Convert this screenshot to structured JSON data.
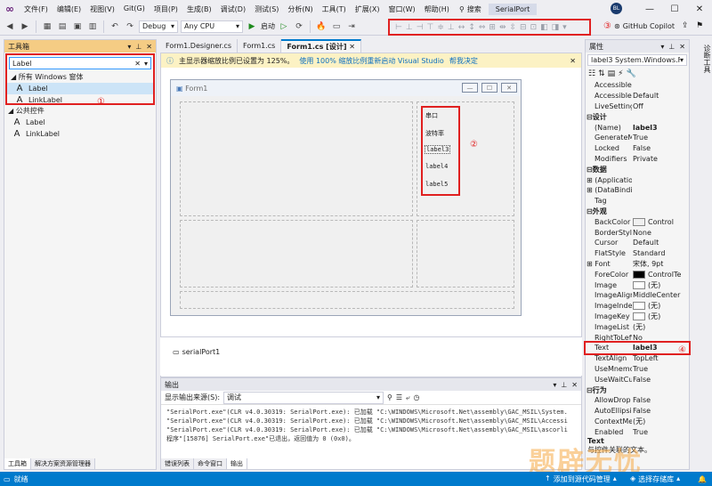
{
  "menu": {
    "items": [
      "文件(F)",
      "编辑(E)",
      "视图(V)",
      "Git(G)",
      "项目(P)",
      "生成(B)",
      "调试(D)",
      "测试(S)",
      "分析(N)",
      "工具(T)",
      "扩展(X)",
      "窗口(W)",
      "帮助(H)"
    ],
    "search_label": "搜索",
    "solution_name": "SerialPort",
    "avatar_initials": "BL"
  },
  "toolbar": {
    "config": "Debug",
    "platform": "Any CPU",
    "start_label": "启动",
    "copilot": "GitHub Copilot",
    "annotation": "③"
  },
  "toolbox": {
    "title": "工具箱",
    "search_value": "Label",
    "annotation": "①",
    "groups": [
      {
        "name": "所有 Windows 窗体",
        "items": [
          "Label",
          "LinkLabel"
        ]
      },
      {
        "name": "公共控件",
        "items": [
          "Label",
          "LinkLabel"
        ]
      }
    ],
    "bottom_tabs": [
      "工具箱",
      "解决方案资源管理器"
    ]
  },
  "doc_tabs": [
    "Form1.Designer.cs",
    "Form1.cs",
    "Form1.cs [设计]"
  ],
  "info_bar": {
    "message": "主显示器缩放比例已设置为 125%。",
    "link1": "使用 100% 缩放比例重新启动 Visual Studio",
    "link2": "帮我决定"
  },
  "form": {
    "title": "Form1",
    "labels": [
      "串口",
      "波特率",
      "label3",
      "label4",
      "label5"
    ],
    "annotation": "②"
  },
  "tray": {
    "component": "serialPort1"
  },
  "output": {
    "title": "输出",
    "source_label": "显示输出来源(S):",
    "source_value": "调试",
    "lines": [
      "\"SerialPort.exe\"(CLR v4.0.30319: SerialPort.exe): 已加载 \"C:\\WINDOWS\\Microsoft.Net\\assembly\\GAC_MSIL\\System.",
      "\"SerialPort.exe\"(CLR v4.0.30319: SerialPort.exe): 已加载 \"C:\\WINDOWS\\Microsoft.Net\\assembly\\GAC_MSIL\\Accessi",
      "\"SerialPort.exe\"(CLR v4.0.30319: SerialPort.exe): 已加载 \"C:\\WINDOWS\\Microsoft.Net\\assembly\\GAC_MSIL\\ascorli",
      "程序\"[15876] SerialPort.exe\"已退出，返回值为 0 (0x0)。"
    ],
    "bottom_tabs": [
      "错误列表",
      "命令窗口",
      "输出"
    ]
  },
  "properties": {
    "title": "属性",
    "object": "label3 System.Windows.Forr",
    "annotation": "④",
    "rows": [
      {
        "t": "p",
        "n": "AccessibleNa",
        "v": ""
      },
      {
        "t": "p",
        "n": "AccessibleRo",
        "v": "Default"
      },
      {
        "t": "p",
        "n": "LiveSetting",
        "v": "Off"
      },
      {
        "t": "c",
        "n": "设计"
      },
      {
        "t": "p",
        "n": "(Name)",
        "v": "label3",
        "b": true
      },
      {
        "t": "p",
        "n": "GenerateMe",
        "v": "True"
      },
      {
        "t": "p",
        "n": "Locked",
        "v": "False"
      },
      {
        "t": "p",
        "n": "Modifiers",
        "v": "Private"
      },
      {
        "t": "c",
        "n": "数据"
      },
      {
        "t": "p",
        "n": "(Application",
        "v": "",
        "x": true
      },
      {
        "t": "p",
        "n": "(DataBinding",
        "v": "",
        "x": true
      },
      {
        "t": "p",
        "n": "Tag",
        "v": ""
      },
      {
        "t": "c",
        "n": "外观"
      },
      {
        "t": "p",
        "n": "BackColor",
        "v": "Control",
        "sw": "#f0f0f0"
      },
      {
        "t": "p",
        "n": "BorderStyle",
        "v": "None"
      },
      {
        "t": "p",
        "n": "Cursor",
        "v": "Default"
      },
      {
        "t": "p",
        "n": "FlatStyle",
        "v": "Standard"
      },
      {
        "t": "p",
        "n": "Font",
        "v": "宋体, 9pt",
        "x": true
      },
      {
        "t": "p",
        "n": "ForeColor",
        "v": "ControlTe",
        "sw": "#000000"
      },
      {
        "t": "p",
        "n": "Image",
        "v": "(无)",
        "sw": "#ffffff"
      },
      {
        "t": "p",
        "n": "ImageAlign",
        "v": "MiddleCenter"
      },
      {
        "t": "p",
        "n": "ImageIndex",
        "v": "(无)",
        "sw": "#ffffff"
      },
      {
        "t": "p",
        "n": "ImageKey",
        "v": "(无)",
        "sw": "#ffffff"
      },
      {
        "t": "p",
        "n": "ImageList",
        "v": "(无)"
      },
      {
        "t": "p",
        "n": "RightToLeft",
        "v": "No"
      },
      {
        "t": "p",
        "n": "Text",
        "v": "label3",
        "b": true,
        "hl": true
      },
      {
        "t": "p",
        "n": "TextAlign",
        "v": "TopLeft"
      },
      {
        "t": "p",
        "n": "UseMnemon",
        "v": "True"
      },
      {
        "t": "p",
        "n": "UseWaitCurs",
        "v": "False"
      },
      {
        "t": "c",
        "n": "行为"
      },
      {
        "t": "p",
        "n": "AllowDrop",
        "v": "False"
      },
      {
        "t": "p",
        "n": "AutoEllipsis",
        "v": "False"
      },
      {
        "t": "p",
        "n": "ContextMen",
        "v": "(无)"
      },
      {
        "t": "p",
        "n": "Enabled",
        "v": "True"
      }
    ],
    "desc_title": "Text",
    "desc_text": "与控件关联的文本。"
  },
  "side_strip": "诊断工具",
  "status": {
    "left": "就绪",
    "source_control": "添加到源代码管理",
    "repo": "选择存储库"
  },
  "watermark": "题辟无忧",
  "colors": {
    "highlight": "#e02020",
    "accent": "#007acc",
    "panel_active": "#f5cc84"
  }
}
